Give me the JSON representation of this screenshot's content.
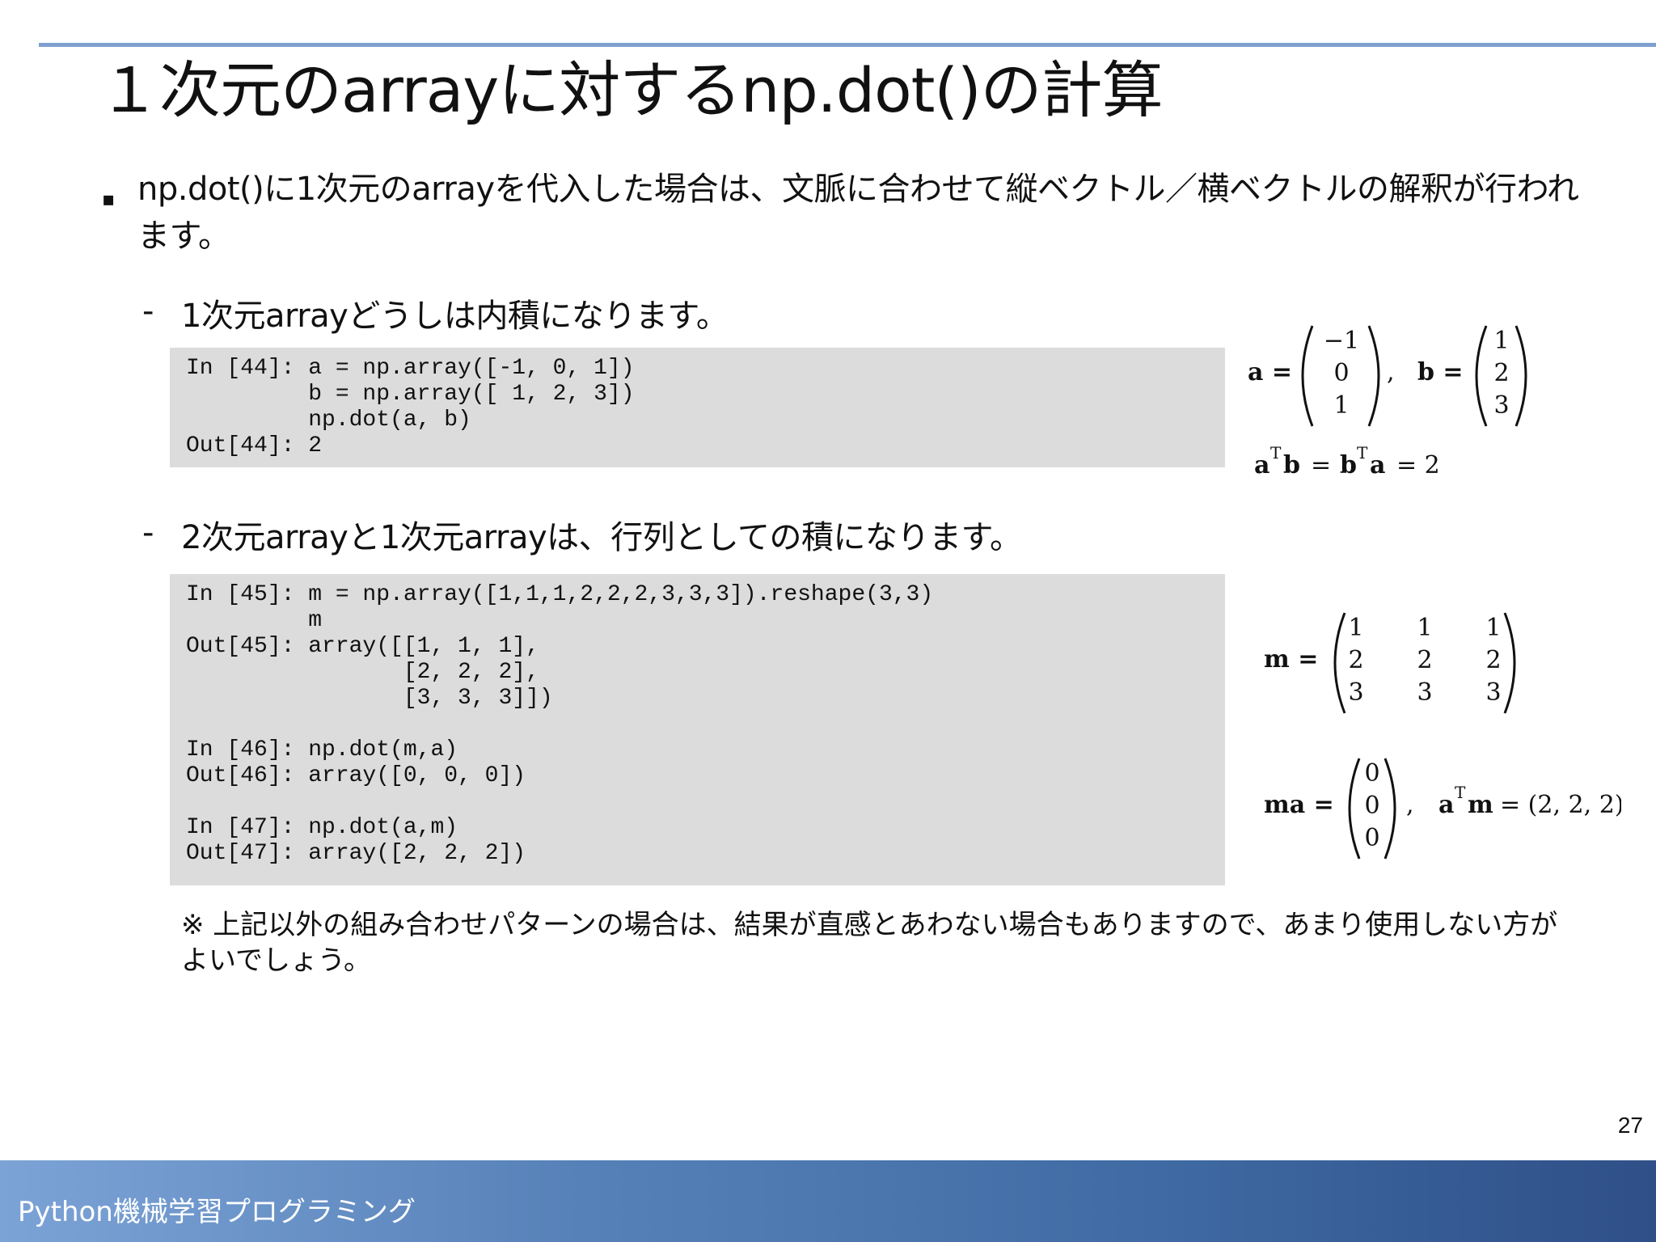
{
  "slide": {
    "title": "１次元のarrayに対するnp.dot()の計算",
    "bullet_marker": "▪",
    "bullet_text": "np.dot()に1次元のarrayを代入した場合は、文脈に合わせて縦ベクトル／横ベクトルの解釈が行われます。",
    "dash_marker": "-",
    "sub1": "1次元arrayどうしは内積になります。",
    "sub2": "2次元arrayと1次元arrayは、行列としての積になります。",
    "code1": "In [44]: a = np.array([-1, 0, 1])\n         b = np.array([ 1, 2, 3])\n         np.dot(a, b)\nOut[44]: 2",
    "code2": "In [45]: m = np.array([1,1,1,2,2,2,3,3,3]).reshape(3,3)\n         m\nOut[45]: array([[1, 1, 1],\n                [2, 2, 2],\n                [3, 3, 3]])\n\nIn [46]: np.dot(m,a)\nOut[46]: array([0, 0, 0])\n\nIn [47]: np.dot(a,m)\nOut[47]: array([2, 2, 2])",
    "note": "※ 上記以外の組み合わせパターンの場合は、結果が直感とあわない場合もありますので、あまり使用しない方がよいでしょう。",
    "page_number": "27",
    "footer": "Python機械学習プログラミング"
  },
  "math": {
    "eq1": {
      "a_label": "a =",
      "a_values": [
        "−1",
        "0",
        "1"
      ],
      "comma": ",",
      "b_label": "b =",
      "b_values": [
        "1",
        "2",
        "3"
      ]
    },
    "eq2": {
      "a": "a",
      "T": "T",
      "b": "b",
      "eq": "=",
      "result": "= 2"
    },
    "eq3": {
      "m_label": "m =",
      "rows": [
        [
          "1",
          "1",
          "1"
        ],
        [
          "2",
          "2",
          "2"
        ],
        [
          "3",
          "3",
          "3"
        ]
      ]
    },
    "eq4": {
      "ma_label": "ma =",
      "ma_values": [
        "0",
        "0",
        "0"
      ],
      "comma": ",",
      "a": "a",
      "T": "T",
      "m": "m",
      "result": "= (2, 2, 2)"
    }
  }
}
